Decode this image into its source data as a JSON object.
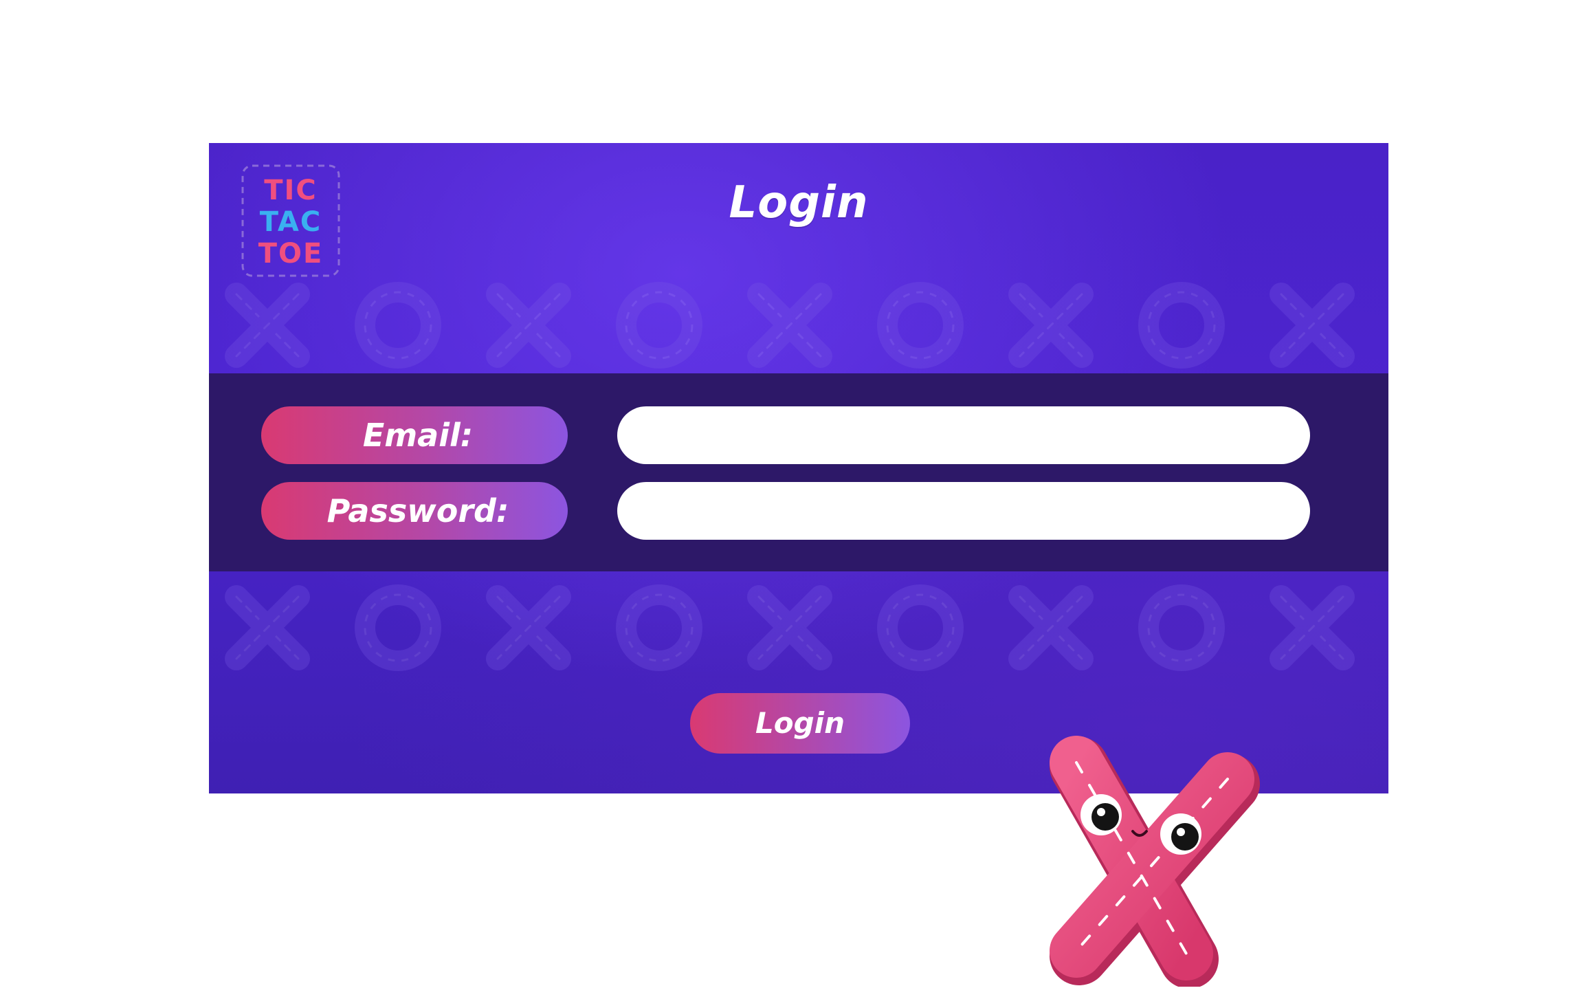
{
  "app": {
    "logo_text_lines": [
      "TIC",
      "TAC",
      "TOE"
    ],
    "title": "Login"
  },
  "form": {
    "email_label": "Email:",
    "email_value": "",
    "email_placeholder": "",
    "password_label": "Password:",
    "password_value": "",
    "password_placeholder": ""
  },
  "actions": {
    "login_label": "Login"
  },
  "decor": {
    "pattern_sequence": [
      "x",
      "o",
      "x",
      "o",
      "x",
      "o",
      "x",
      "o",
      "x"
    ],
    "mascot": "x-mascot-icon"
  },
  "colors": {
    "card_bg": "#4a22c8",
    "band_bg": "#2d1868",
    "pill_gradient_start": "#d93a72",
    "pill_gradient_end": "#8c55e0",
    "mascot_pink": "#e84a7c",
    "logo_pink": "#f04f7f",
    "logo_blue": "#3ab0f0"
  }
}
